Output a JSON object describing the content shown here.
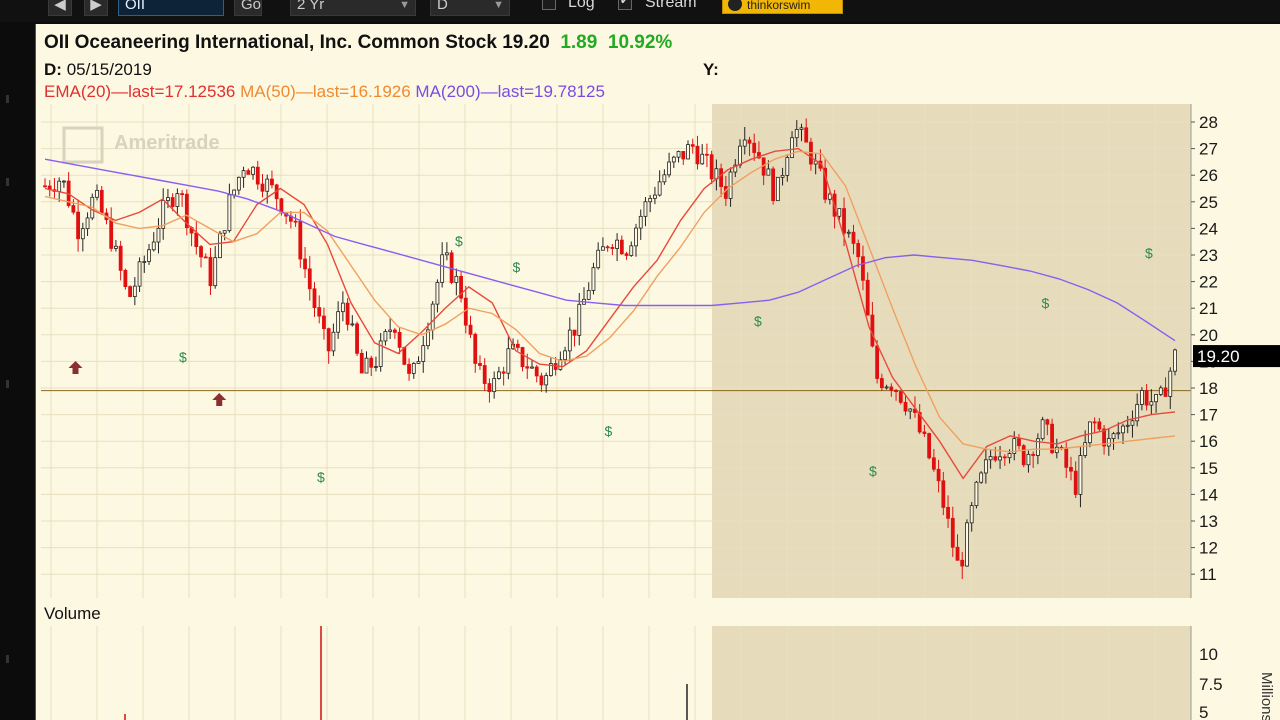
{
  "toolbar": {
    "symbol_value": "OII",
    "go_label": "Go",
    "period_value": "2 Yr",
    "aggregation_value": "D",
    "log_label": "Log",
    "log_checked": false,
    "stream_label": "Stream",
    "stream_checked": true,
    "brand_label": "thinkorswim"
  },
  "header": {
    "symbol": "OII",
    "company": "Oceaneering International, Inc. Common Stock",
    "last": "19.20",
    "change": "1.89",
    "change_pct": "10.92%",
    "date_label": "D:",
    "date_value": "05/15/2019",
    "y_label": "Y:",
    "studies": [
      {
        "label": "EMA(20)",
        "sep": "—",
        "value": "last=17.12536",
        "color": "#e03030"
      },
      {
        "label": "MA(50)",
        "sep": "—",
        "value": "last=16.1926",
        "color": "#f08a30"
      },
      {
        "label": "MA(200)",
        "sep": "—",
        "value": "last=19.78125",
        "color": "#7a4de0"
      }
    ]
  },
  "watermark": "Ameritrade",
  "price_badge": "19.20",
  "volume_title": "Volume",
  "volume_unit": "Millions",
  "colors": {
    "background": "#fdf8e2",
    "shaded": "#e6dcbc",
    "positive": "#22aa22",
    "candle_down": "#e01010",
    "candle_up": "#222222"
  },
  "chart_data": {
    "type": "line",
    "y_ticks": [
      11,
      12,
      13,
      14,
      15,
      16,
      17,
      18,
      19,
      20,
      21,
      22,
      23,
      24,
      25,
      26,
      27,
      28
    ],
    "ylim": [
      10.5,
      28.7
    ],
    "volume_ticks": [
      "10",
      "7.5",
      "5"
    ],
    "series": [
      {
        "name": "EMA(20)",
        "values": [
          25.5,
          25.3,
          24.7,
          24.3,
          24.6,
          25.1,
          24.2,
          23.4,
          23.5,
          24.9,
          25.5,
          24.9,
          23.4,
          21.2,
          19.7,
          19.3,
          20.1,
          21.0,
          21.8,
          21.2,
          19.4,
          18.9,
          18.8,
          19.4,
          20.6,
          21.8,
          22.8,
          24.3,
          25.5,
          26.2,
          26.6,
          26.9,
          27.0,
          26.4,
          23.5,
          20.3,
          18.4,
          17.2,
          16.0,
          14.6,
          15.8,
          16.2,
          16.0,
          15.9,
          16.2,
          16.4,
          16.8,
          17.0,
          17.1
        ]
      },
      {
        "name": "MA(50)",
        "values": [
          25.2,
          25.0,
          24.8,
          24.2,
          24.0,
          24.1,
          24.5,
          24.0,
          23.5,
          23.8,
          24.6,
          24.6,
          23.9,
          22.6,
          21.3,
          20.3,
          20.0,
          20.4,
          21.0,
          20.8,
          20.2,
          19.3,
          19.0,
          19.2,
          19.9,
          20.9,
          22.2,
          23.3,
          24.6,
          25.5,
          26.1,
          26.6,
          26.9,
          26.8,
          25.6,
          23.3,
          21.0,
          18.8,
          16.9,
          15.9,
          15.7,
          15.6,
          15.7,
          15.7,
          15.8,
          15.9,
          16.0,
          16.1,
          16.2
        ]
      },
      {
        "name": "MA(200)",
        "values": [
          26.6,
          26.4,
          26.2,
          26.0,
          25.8,
          25.6,
          25.4,
          25.1,
          24.7,
          24.2,
          23.7,
          23.4,
          23.1,
          22.8,
          22.5,
          22.2,
          21.9,
          21.6,
          21.3,
          21.2,
          21.1,
          21.1,
          21.1,
          21.1,
          21.2,
          21.3,
          21.6,
          22.1,
          22.6,
          22.9,
          23.0,
          22.9,
          22.8,
          22.6,
          22.4,
          22.1,
          21.7,
          21.2,
          20.5,
          19.78
        ]
      },
      {
        "name": "Close",
        "values": [
          25.6,
          25.9,
          24.0,
          25.2,
          23.6,
          21.3,
          22.8,
          24.5,
          25.6,
          23.5,
          22.1,
          24.8,
          26.5,
          25.9,
          25.2,
          24.1,
          21.6,
          19.3,
          21.4,
          18.5,
          19.1,
          20.6,
          18.1,
          20.5,
          22.9,
          21.7,
          18.5,
          18.1,
          19.4,
          18.9,
          18.2,
          19.5,
          20.4,
          22.4,
          23.7,
          23.3,
          24.7,
          25.8,
          26.6,
          27.1,
          26.2,
          25.4,
          27.9,
          26.7,
          25.2,
          27.9,
          26.9,
          25.3,
          24.1,
          22.8,
          18.4,
          18.2,
          17.3,
          15.8,
          13.8,
          11.1,
          14.0,
          15.6,
          15.9,
          15.4,
          16.5,
          15.6,
          14.3,
          16.8,
          15.9,
          16.6,
          17.8,
          17.3,
          19.2
        ]
      }
    ],
    "dividends": 9,
    "splits": 2,
    "horizontal_line": 17.9
  }
}
